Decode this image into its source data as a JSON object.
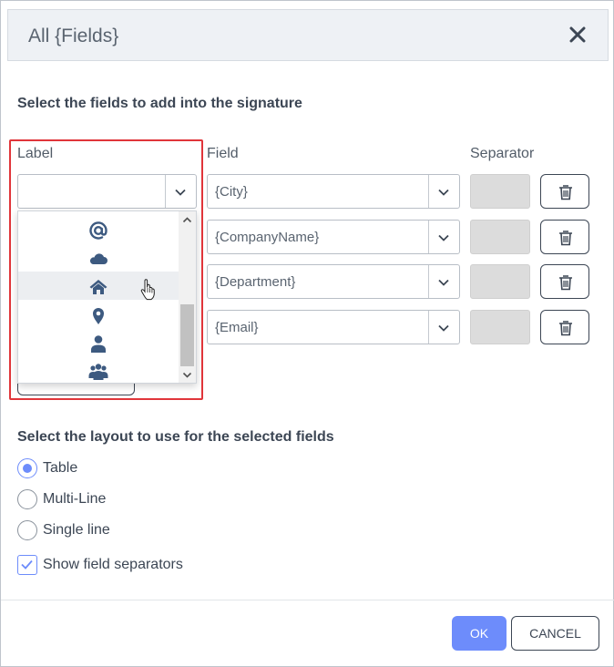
{
  "dialog": {
    "title": "All {Fields}"
  },
  "fields_section": {
    "heading": "Select the fields to add into the signature",
    "columns": {
      "label": "Label",
      "field": "Field",
      "separator": "Separator"
    },
    "rows": [
      {
        "label_value": "",
        "field_value": "{City}"
      },
      {
        "field_value": "{CompanyName}"
      },
      {
        "field_value": "{Department}"
      },
      {
        "field_value": "{Email}"
      }
    ]
  },
  "label_dropdown": {
    "options": [
      "at-sign-icon",
      "cloud-icon",
      "home-icon",
      "location-pin-icon",
      "person-icon",
      "group-icon"
    ],
    "hovered_option": "home-icon"
  },
  "layout_section": {
    "heading": "Select the layout to use for the selected fields",
    "options": [
      {
        "label": "Table",
        "selected": true
      },
      {
        "label": "Multi-Line",
        "selected": false
      },
      {
        "label": "Single line",
        "selected": false
      }
    ],
    "show_separators": {
      "label": "Show field separators",
      "checked": true
    }
  },
  "footer": {
    "ok_label": "OK",
    "cancel_label": "CANCEL"
  },
  "colors": {
    "accent": "#6d8cfb",
    "icon": "#3d5a80",
    "highlight_border": "#e0353a"
  }
}
